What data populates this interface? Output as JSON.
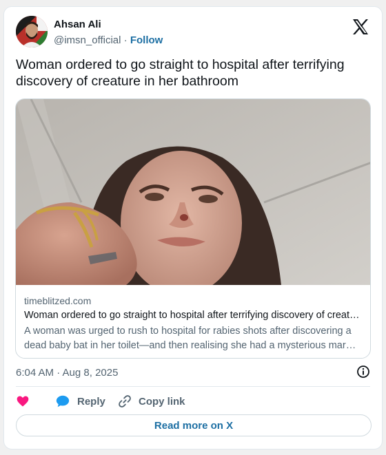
{
  "author": {
    "name": "Ahsan Ali",
    "handle": "@imsn_official",
    "separator": "·",
    "follow_label": "Follow",
    "avatar_icon": "user-avatar-photo"
  },
  "platform_logo": "x-logo",
  "tweet": {
    "text": "Woman ordered to go straight to hospital after terrifying discovery of creature in her bathroom"
  },
  "link_card": {
    "image_icon": "article-photo",
    "domain": "timeblitzed.com",
    "title": "Woman ordered to go straight to hospital after terrifying discovery of creature in her bathroom",
    "description": "A woman was urged to rush to hospital for rabies shots after discovering a dead baby bat in her toilet—and then realising she had a mysterious mark on her nose."
  },
  "timestamp": "6:04 AM · Aug 8, 2025",
  "actions": {
    "like_icon": "heart-icon",
    "reply_label": "Reply",
    "reply_icon": "speech-bubble-icon",
    "copy_label": "Copy link",
    "copy_icon": "link-icon"
  },
  "read_more_label": "Read more on X",
  "colors": {
    "accent": "#1d6fa3",
    "like": "#f91880",
    "reply": "#1d9bf0",
    "muted": "#536471"
  }
}
